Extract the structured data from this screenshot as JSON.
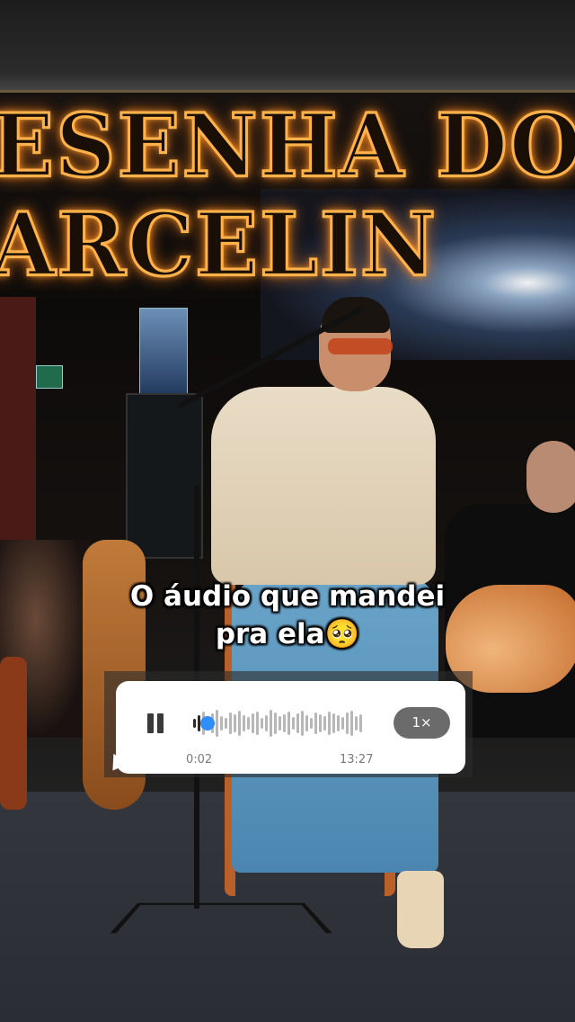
{
  "caption": {
    "line1": "O áudio que mandei",
    "line2": "pra ela🥺"
  },
  "audio": {
    "elapsed": "0:02",
    "duration": "13:27",
    "speed": "1×",
    "state": "playing",
    "progress": 0.03,
    "accent": "#2f8ef7"
  },
  "scene": {
    "sign_line1": "ESENHA DO",
    "sign_line2": "ARCELIN",
    "sign_color": "#ffb24a"
  },
  "icons": {
    "pause": "pause-icon"
  }
}
